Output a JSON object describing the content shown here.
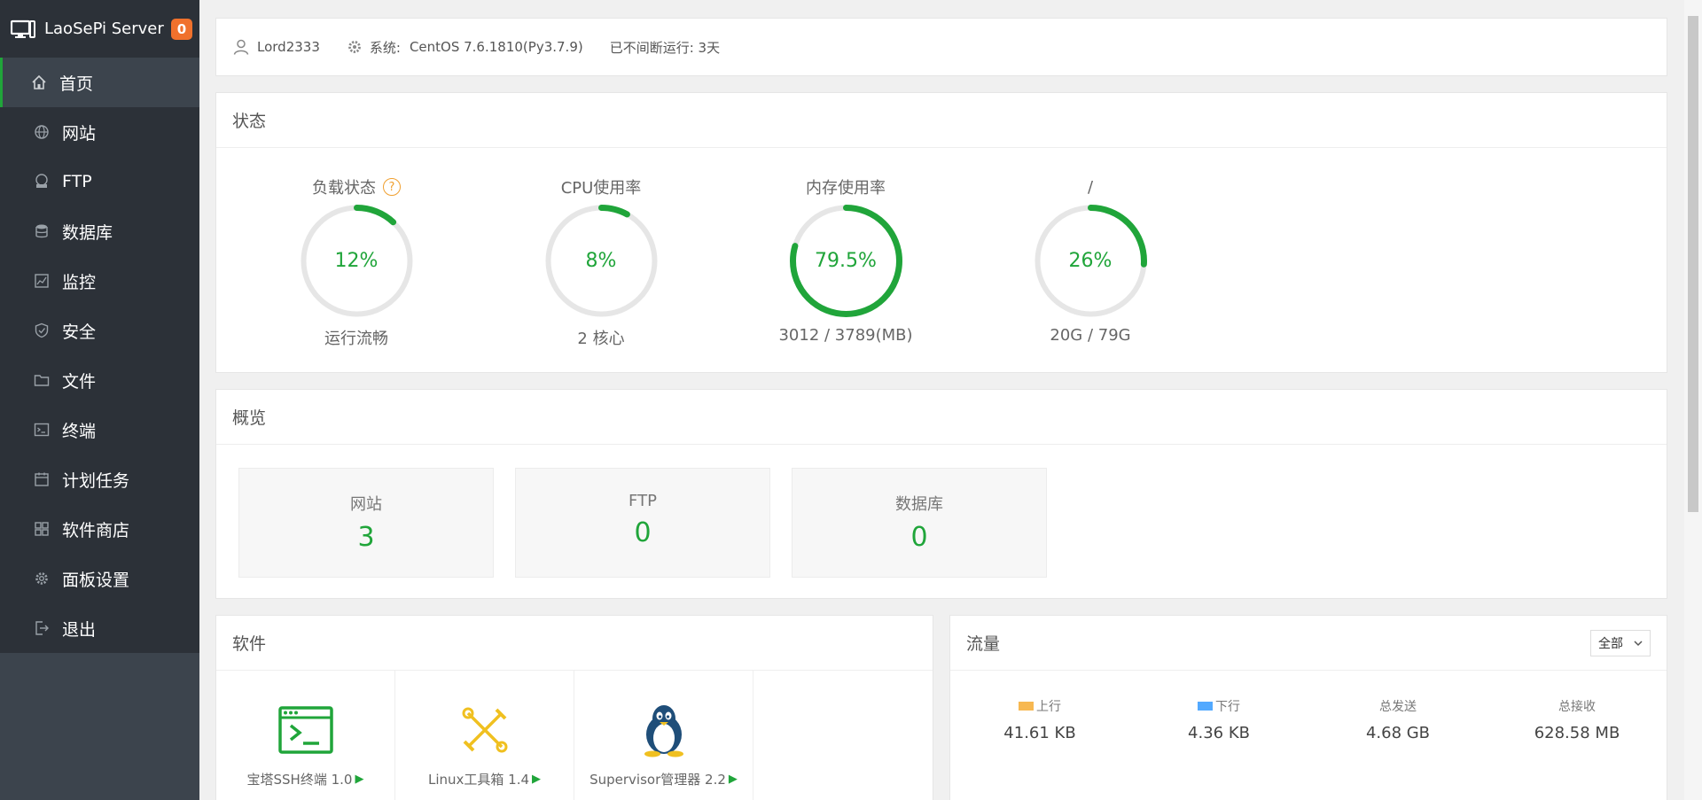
{
  "brand": {
    "title": "LaoSePi Server",
    "badge": "0"
  },
  "sidebar": {
    "items": [
      {
        "label": "首页",
        "icon": "home-icon",
        "active": true
      },
      {
        "label": "网站",
        "icon": "globe-icon"
      },
      {
        "label": "FTP",
        "icon": "ftp-icon"
      },
      {
        "label": "数据库",
        "icon": "database-icon"
      },
      {
        "label": "监控",
        "icon": "monitor-icon"
      },
      {
        "label": "安全",
        "icon": "shield-icon"
      },
      {
        "label": "文件",
        "icon": "folder-icon"
      },
      {
        "label": "终端",
        "icon": "terminal-icon"
      },
      {
        "label": "计划任务",
        "icon": "calendar-icon"
      },
      {
        "label": "软件商店",
        "icon": "grid-icon"
      },
      {
        "label": "面板设置",
        "icon": "gear-icon"
      },
      {
        "label": "退出",
        "icon": "logout-icon"
      }
    ]
  },
  "header": {
    "user": "Lord2333",
    "system_label": "系统:",
    "system_value": "CentOS 7.6.1810(Py3.7.9)",
    "uptime": "已不间断运行: 3天"
  },
  "status": {
    "title": "状态",
    "gauges": [
      {
        "title": "负载状态",
        "percent_text": "12%",
        "percent": 12,
        "sub": "运行流畅",
        "help": "?"
      },
      {
        "title": "CPU使用率",
        "percent_text": "8%",
        "percent": 8,
        "sub": "2 核心"
      },
      {
        "title": "内存使用率",
        "percent_text": "79.5%",
        "percent": 79.5,
        "sub": "3012 / 3789(MB)"
      },
      {
        "title": "/",
        "percent_text": "26%",
        "percent": 26,
        "sub": "20G / 79G"
      }
    ]
  },
  "overview": {
    "title": "概览",
    "boxes": [
      {
        "label": "网站",
        "value": "3"
      },
      {
        "label": "FTP",
        "value": "0"
      },
      {
        "label": "数据库",
        "value": "0"
      }
    ]
  },
  "software": {
    "title": "软件",
    "items": [
      {
        "label": "宝塔SSH终端 1.0",
        "icon": "ssh-terminal-icon",
        "play": "▶"
      },
      {
        "label": "Linux工具箱 1.4",
        "icon": "toolbox-icon",
        "play": "▶"
      },
      {
        "label": "Supervisor管理器 2.2",
        "icon": "penguin-icon",
        "play": "▶"
      }
    ]
  },
  "flow": {
    "title": "流量",
    "select": "全部",
    "stats": [
      {
        "label": "上行",
        "value": "41.61 KB",
        "color": "#f7b851"
      },
      {
        "label": "下行",
        "value": "4.36 KB",
        "color": "#52a9ff"
      },
      {
        "label": "总发送",
        "value": "4.68 GB"
      },
      {
        "label": "总接收",
        "value": "628.58 MB"
      }
    ]
  },
  "colors": {
    "accent": "#20a53a",
    "sidebar": "#3c444d",
    "badge": "#f0712c"
  }
}
